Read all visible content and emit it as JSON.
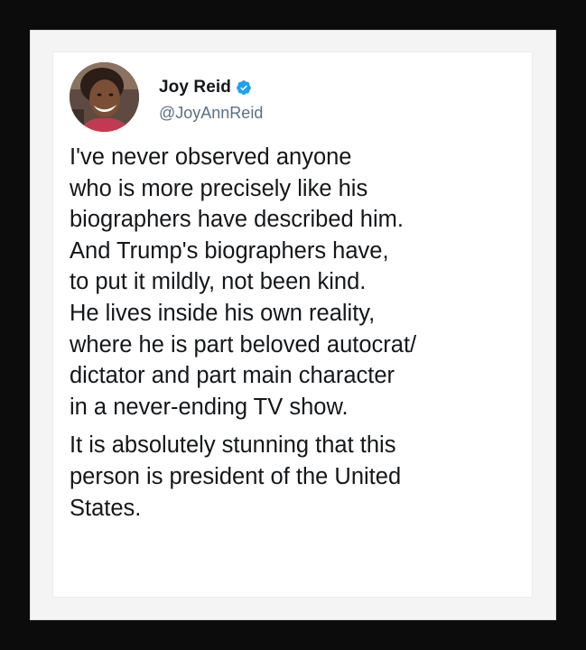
{
  "tweet": {
    "display_name": "Joy Reid",
    "handle": "@JoyAnnReid",
    "verified": true,
    "avatar_icon": "profile-photo",
    "verified_icon": "verified-badge-icon",
    "verified_color": "#1da1f2",
    "paragraphs": [
      {
        "lines": [
          "I've never observed anyone",
          "who is more precisely like his",
          "biographers have described him.",
          "And Trump's biographers have,",
          "to put it mildly, not been kind.",
          "He lives inside his own reality,",
          "where he is part beloved autocrat/",
          "dictator and part main character",
          "in a never-ending TV show."
        ]
      },
      {
        "lines": [
          "It is absolutely stunning that this",
          "person is president of the United",
          "States."
        ]
      }
    ]
  },
  "colors": {
    "frame": "#0c0c0c",
    "mat": "#f4f4f4",
    "card": "#ffffff",
    "text": "#14171a",
    "handle": "#5b7083"
  }
}
